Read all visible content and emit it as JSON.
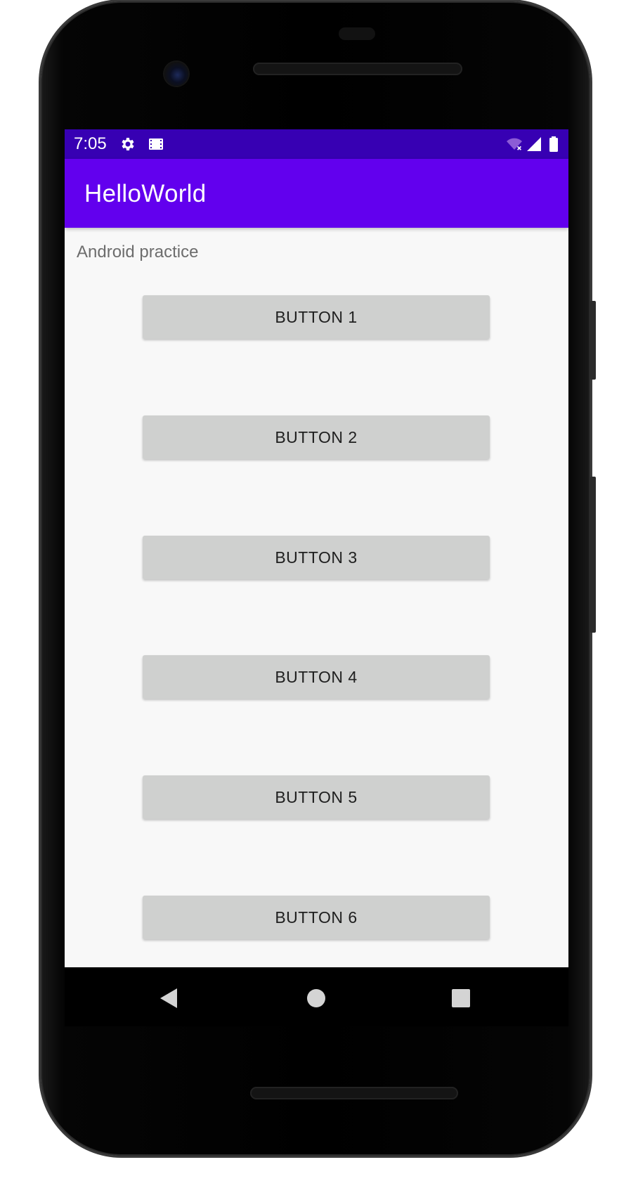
{
  "status_bar": {
    "time": "7:05",
    "icons": [
      "settings-gear-icon",
      "film-icon",
      "wifi-off-icon",
      "signal-icon",
      "battery-icon"
    ],
    "color": "#3700b3"
  },
  "app_bar": {
    "title": "HelloWorld",
    "color": "#6200ee"
  },
  "content": {
    "intro_text": "Android practice",
    "buttons": [
      {
        "label": "BUTTON 1"
      },
      {
        "label": "BUTTON 2"
      },
      {
        "label": "BUTTON 3"
      },
      {
        "label": "BUTTON 4"
      },
      {
        "label": "BUTTON 5"
      },
      {
        "label": "BUTTON 6"
      }
    ],
    "button_color": "#cfd0cf"
  },
  "nav_bar": {
    "icons": [
      "back-icon",
      "home-icon",
      "recents-icon"
    ]
  }
}
